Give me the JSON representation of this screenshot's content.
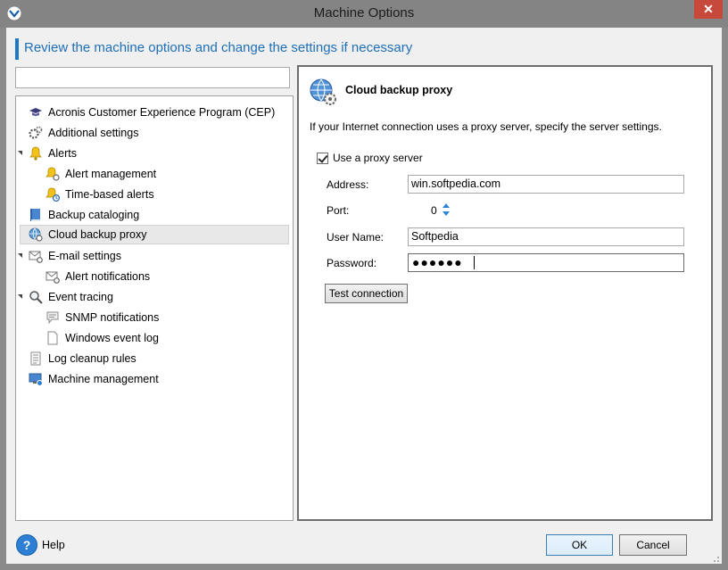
{
  "window": {
    "title": "Machine Options",
    "close_glyph": "✕"
  },
  "header": {
    "text": "Review the machine options and change the settings if necessary"
  },
  "filter": {
    "value": ""
  },
  "tree": [
    {
      "label": "Acronis Customer Experience Program (CEP)",
      "icon": "graduation-cap-icon"
    },
    {
      "label": "Additional settings",
      "icon": "gears-icon"
    },
    {
      "label": "Alerts",
      "icon": "bell-icon",
      "expanded": true
    },
    {
      "label": "Alert management",
      "icon": "bell-settings-icon"
    },
    {
      "label": "Time-based alerts",
      "icon": "bell-clock-icon"
    },
    {
      "label": "Backup cataloging",
      "icon": "book-icon"
    },
    {
      "label": "Cloud backup proxy",
      "icon": "globe-gear-icon",
      "selected": true
    },
    {
      "label": "E-mail settings",
      "icon": "mail-gear-icon",
      "expanded": true
    },
    {
      "label": "Alert notifications",
      "icon": "mail-gear-icon"
    },
    {
      "label": "Event tracing",
      "icon": "magnifier-icon",
      "expanded": true
    },
    {
      "label": "SNMP notifications",
      "icon": "speech-bubble-icon"
    },
    {
      "label": "Windows event log",
      "icon": "document-icon"
    },
    {
      "label": "Log cleanup rules",
      "icon": "list-document-icon"
    },
    {
      "label": "Machine management",
      "icon": "monitor-gear-icon"
    }
  ],
  "panel": {
    "title": "Cloud backup proxy",
    "description": "If your Internet connection uses a proxy server, specify the server settings.",
    "use_proxy_label": "Use a proxy server",
    "use_proxy_checked": true,
    "address_label": "Address:",
    "address_value": "win.softpedia.com",
    "port_label": "Port:",
    "port_value": "0",
    "username_label": "User Name:",
    "username_value": "Softpedia",
    "password_label": "Password:",
    "password_mask": "●●●●●●",
    "test_button": "Test connection"
  },
  "footer": {
    "help_glyph": "?",
    "help_label": "Help",
    "ok_label": "OK",
    "cancel_label": "Cancel"
  },
  "colors": {
    "accent": "#1e78c8",
    "titlebar": "#848484",
    "close": "#c7493b"
  }
}
